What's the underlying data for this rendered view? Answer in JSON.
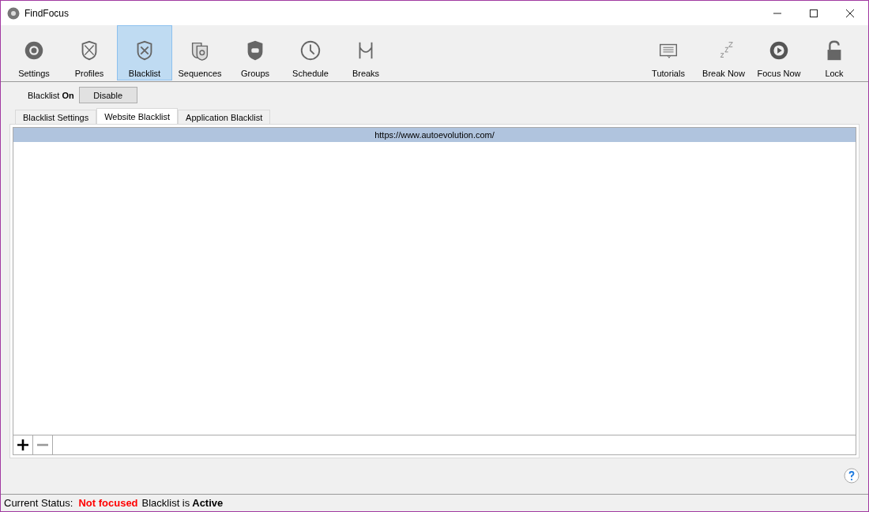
{
  "window": {
    "title": "FindFocus"
  },
  "toolbar": {
    "left": [
      {
        "label": "Settings",
        "selected": false
      },
      {
        "label": "Profiles",
        "selected": false
      },
      {
        "label": "Blacklist",
        "selected": true
      },
      {
        "label": "Sequences",
        "selected": false
      },
      {
        "label": "Groups",
        "selected": false
      },
      {
        "label": "Schedule",
        "selected": false
      },
      {
        "label": "Breaks",
        "selected": false
      }
    ],
    "right": [
      {
        "label": "Tutorials"
      },
      {
        "label": "Break Now"
      },
      {
        "label": "Focus Now"
      },
      {
        "label": "Lock"
      }
    ]
  },
  "blacklist_toggle": {
    "label": "Blacklist **On**",
    "button": "Disable"
  },
  "tabs": [
    {
      "label": "Blacklist Settings",
      "selected": false
    },
    {
      "label": "Website Blacklist",
      "selected": true
    },
    {
      "label": "Application Blacklist",
      "selected": false
    }
  ],
  "table": {
    "rows": [
      {
        "url": "https://www.autoevolution.com/",
        "selected": true
      }
    ],
    "remove_disabled": true
  },
  "status_bar": {
    "label": "Current Status:",
    "focus": "Not focused",
    "blacklist_label": "Blacklist is",
    "blacklist_state": "Active"
  }
}
